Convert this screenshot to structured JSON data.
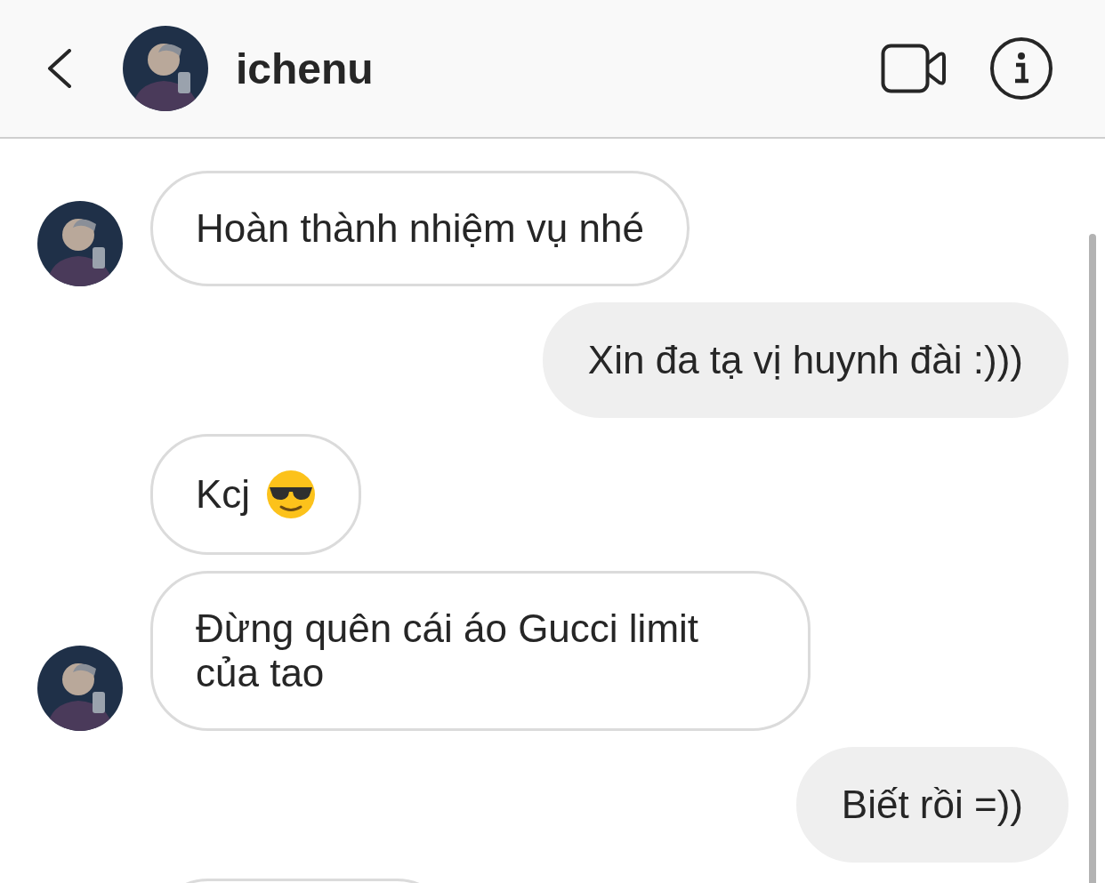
{
  "header": {
    "username": "ichenu"
  },
  "messages": [
    {
      "kind": "received",
      "avatar": true,
      "text": "Hoàn thành nhiệm vụ nhé",
      "emoji": false
    },
    {
      "kind": "sent",
      "text": "Xin đa tạ vị huynh đài :)))",
      "emoji": false
    },
    {
      "kind": "received",
      "avatar": false,
      "text": "Kcj",
      "emoji": true
    },
    {
      "kind": "received",
      "avatar": true,
      "text": "Đừng quên cái áo Gucci limit của tao",
      "emoji": false
    },
    {
      "kind": "sent",
      "text": "Biết rồi =))",
      "emoji": false
    },
    {
      "kind": "received",
      "avatar": false
    }
  ]
}
